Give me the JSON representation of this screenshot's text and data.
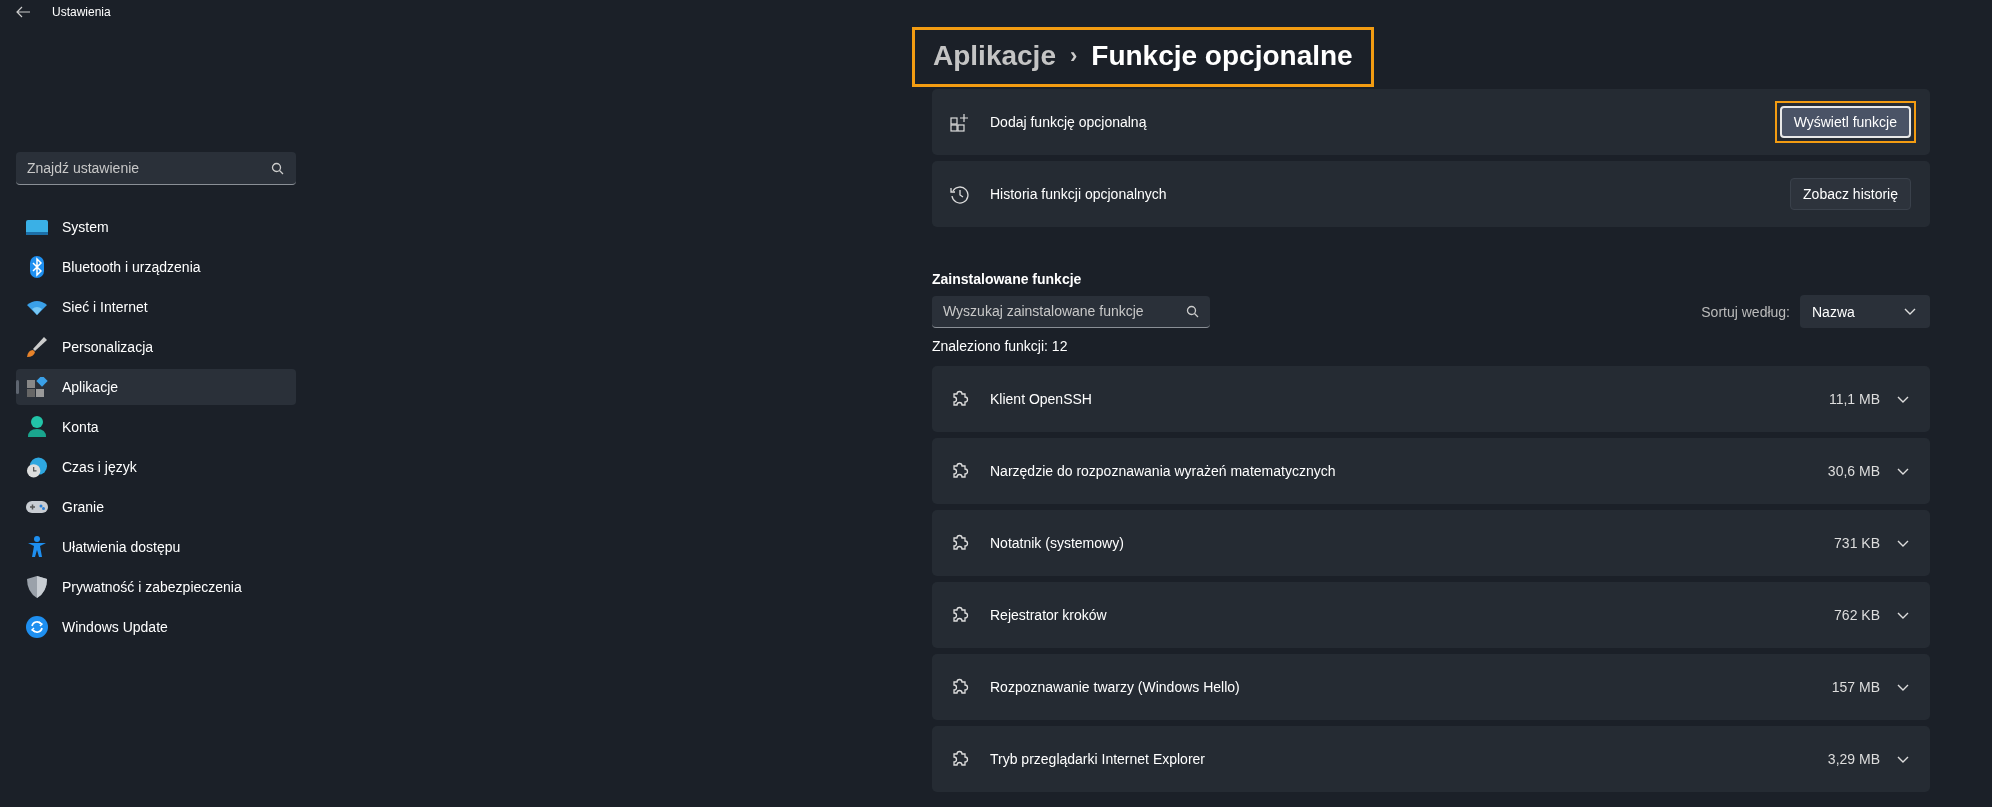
{
  "window": {
    "title": "Ustawienia"
  },
  "sidebar": {
    "search": {
      "placeholder": "Znajdź ustawienie"
    },
    "items": [
      {
        "label": "System",
        "selected": false
      },
      {
        "label": "Bluetooth i urządzenia",
        "selected": false
      },
      {
        "label": "Sieć i Internet",
        "selected": false
      },
      {
        "label": "Personalizacja",
        "selected": false
      },
      {
        "label": "Aplikacje",
        "selected": true
      },
      {
        "label": "Konta",
        "selected": false
      },
      {
        "label": "Czas i język",
        "selected": false
      },
      {
        "label": "Granie",
        "selected": false
      },
      {
        "label": "Ułatwienia dostępu",
        "selected": false
      },
      {
        "label": "Prywatność i zabezpieczenia",
        "selected": false
      },
      {
        "label": "Windows Update",
        "selected": false
      }
    ]
  },
  "breadcrumb": {
    "parent": "Aplikacje",
    "separator": "›",
    "current": "Funkcje opcjonalne",
    "highlighted": true
  },
  "action_cards": [
    {
      "label": "Dodaj funkcję opcjonalną",
      "button": "Wyświetl funkcje",
      "highlighted": true
    },
    {
      "label": "Historia funkcji opcjonalnych",
      "button": "Zobacz historię",
      "highlighted": false
    }
  ],
  "installed": {
    "heading": "Zainstalowane funkcje",
    "search": {
      "placeholder": "Wyszukaj zainstalowane funkcje"
    },
    "sort_label": "Sortuj według:",
    "sort_value": "Nazwa",
    "count": "Znaleziono funkcji: 12",
    "features": [
      {
        "name": "Klient OpenSSH",
        "size": "11,1 MB",
        "expanded": false
      },
      {
        "name": "Narzędzie do rozpoznawania wyrażeń matematycznych",
        "size": "30,6 MB",
        "expanded": false
      },
      {
        "name": "Notatnik (systemowy)",
        "size": "731 KB",
        "expanded": false
      },
      {
        "name": "Rejestrator kroków",
        "size": "762 KB",
        "expanded": false
      },
      {
        "name": "Rozpoznawanie twarzy (Windows Hello)",
        "size": "157 MB",
        "expanded": false
      },
      {
        "name": "Tryb przeglądarki Internet Explorer",
        "size": "3,29 MB",
        "expanded": false
      }
    ]
  }
}
